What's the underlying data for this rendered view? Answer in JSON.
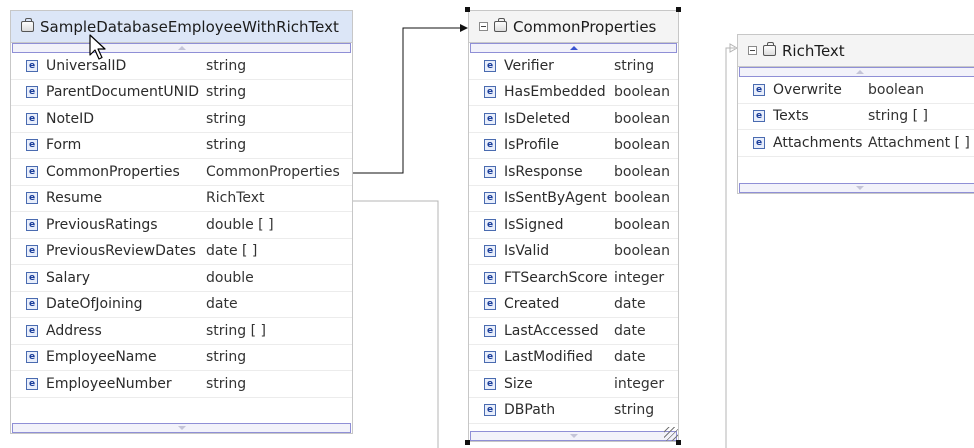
{
  "diagram": {
    "tables": [
      {
        "id": "emp",
        "name": "SampleDatabaseEmployeeWithRichText",
        "selected": true,
        "fields": [
          {
            "name": "UniversalID",
            "type": "string"
          },
          {
            "name": "ParentDocumentUNID",
            "type": "string"
          },
          {
            "name": "NoteID",
            "type": "string"
          },
          {
            "name": "Form",
            "type": "string"
          },
          {
            "name": "CommonProperties",
            "type": "CommonProperties"
          },
          {
            "name": "Resume",
            "type": "RichText"
          },
          {
            "name": "PreviousRatings",
            "type": "double [ ]"
          },
          {
            "name": "PreviousReviewDates",
            "type": "date [ ]"
          },
          {
            "name": "Salary",
            "type": "double"
          },
          {
            "name": "DateOfJoining",
            "type": "date"
          },
          {
            "name": "Address",
            "type": "string [ ]"
          },
          {
            "name": "EmployeeName",
            "type": "string"
          },
          {
            "name": "EmployeeNumber",
            "type": "string"
          }
        ]
      },
      {
        "id": "cp",
        "name": "CommonProperties",
        "selected": false,
        "fields": [
          {
            "name": "Verifier",
            "type": "string"
          },
          {
            "name": "HasEmbedded",
            "type": "boolean"
          },
          {
            "name": "IsDeleted",
            "type": "boolean"
          },
          {
            "name": "IsProfile",
            "type": "boolean"
          },
          {
            "name": "IsResponse",
            "type": "boolean"
          },
          {
            "name": "IsSentByAgent",
            "type": "boolean"
          },
          {
            "name": "IsSigned",
            "type": "boolean"
          },
          {
            "name": "IsValid",
            "type": "boolean"
          },
          {
            "name": "FTSearchScore",
            "type": "integer"
          },
          {
            "name": "Created",
            "type": "date"
          },
          {
            "name": "LastAccessed",
            "type": "date"
          },
          {
            "name": "LastModified",
            "type": "date"
          },
          {
            "name": "Size",
            "type": "integer"
          },
          {
            "name": "DBPath",
            "type": "string"
          }
        ]
      },
      {
        "id": "rt",
        "name": "RichText",
        "selected": false,
        "fields": [
          {
            "name": "Overwrite",
            "type": "boolean"
          },
          {
            "name": "Texts",
            "type": "string [ ]"
          },
          {
            "name": "Attachments",
            "type": "Attachment [ ]"
          }
        ]
      }
    ],
    "colors": {
      "selected_header": "#dce6f7",
      "scroll_border": "#8f8fd6",
      "field_icon": "#1c3f9b",
      "connector": "#111111",
      "inactive_connector": "#b4b4b4"
    },
    "icons": {
      "field": "element-icon",
      "table": "class-icon",
      "collapse": "collapse-icon"
    }
  }
}
